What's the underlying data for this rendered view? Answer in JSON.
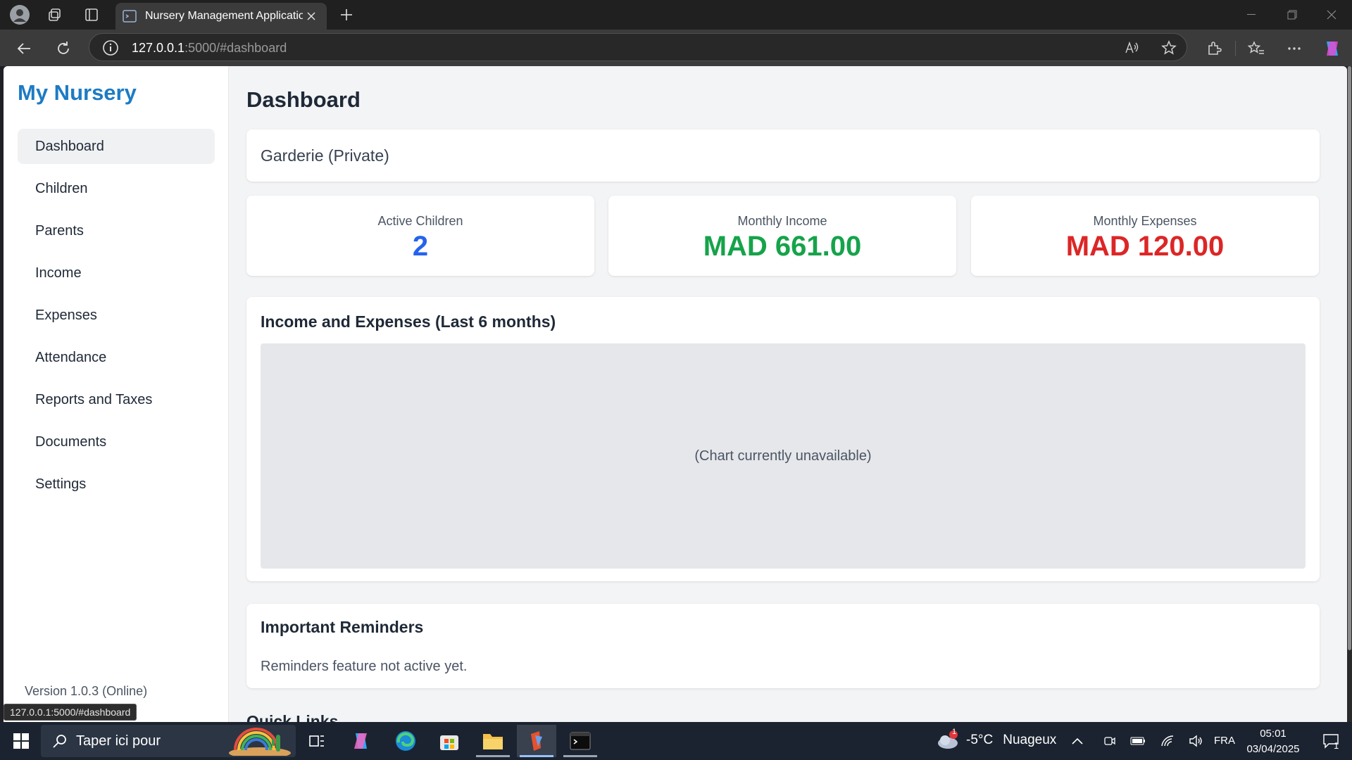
{
  "browser": {
    "tab_title": "Nursery Management Application",
    "url_host": "127.0.0.1",
    "url_rest": ":5000/#dashboard",
    "status_url": "127.0.0.1:5000/#dashboard"
  },
  "sidebar": {
    "brand": "My Nursery",
    "items": [
      {
        "label": "Dashboard",
        "active": true
      },
      {
        "label": "Children"
      },
      {
        "label": "Parents"
      },
      {
        "label": "Income"
      },
      {
        "label": "Expenses"
      },
      {
        "label": "Attendance"
      },
      {
        "label": "Reports and Taxes"
      },
      {
        "label": "Documents"
      },
      {
        "label": "Settings"
      }
    ],
    "version": "Version 1.0.3 (Online)"
  },
  "main": {
    "title": "Dashboard",
    "nursery_type": "Garderie (Private)",
    "stats": [
      {
        "label": "Active Children",
        "value": "2",
        "color": "#2563eb"
      },
      {
        "label": "Monthly Income",
        "value": "MAD 661.00",
        "color": "#16a34a"
      },
      {
        "label": "Monthly Expenses",
        "value": "MAD 120.00",
        "color": "#dc2626"
      }
    ],
    "chart": {
      "title": "Income and Expenses (Last 6 months)",
      "message": "(Chart currently unavailable)"
    },
    "reminders": {
      "title": "Important Reminders",
      "text": "Reminders feature not active yet."
    },
    "quick_links_title": "Quick Links"
  },
  "taskbar": {
    "search_placeholder": "Taper ici pour",
    "weather_badge": "1",
    "weather_temp": "-5°C",
    "weather_desc": "Nuageux",
    "language": "FRA",
    "time": "05:01",
    "date": "03/04/2025",
    "notifications": "1"
  },
  "colors": {
    "brand": "#1d7bc4",
    "accent_blue": "#2563eb",
    "income_green": "#16a34a",
    "expense_red": "#dc2626"
  }
}
